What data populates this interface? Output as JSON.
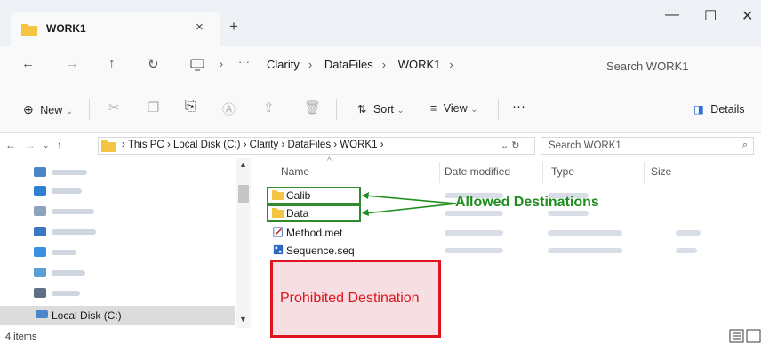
{
  "tab": {
    "title": "WORK1",
    "close": "×",
    "new_tab": "+"
  },
  "window_controls": {
    "minimize": "—",
    "maximize": "☐",
    "close": "✕"
  },
  "nav": {
    "back": "←",
    "forward": "→",
    "up": "↑",
    "refresh": "↻",
    "more": "···"
  },
  "breadcrumbs": [
    "Clarity",
    "DataFiles",
    "WORK1"
  ],
  "search": {
    "placeholder": "Search WORK1"
  },
  "toolbar": {
    "new_label": "New",
    "sort_label": "Sort",
    "view_label": "View",
    "more_label": "···",
    "details_label": "Details"
  },
  "classic_address": {
    "path": [
      "This PC",
      "Local Disk (C:)",
      "Clarity",
      "DataFiles",
      "WORK1"
    ],
    "search_placeholder": "Search WORK1"
  },
  "nav_pane": {
    "items": [
      {
        "icon": "3d-objects-icon",
        "color": "#4a86c8"
      },
      {
        "icon": "desktop-icon",
        "color": "#2f7fd3"
      },
      {
        "icon": "documents-icon",
        "color": "#8da4bf"
      },
      {
        "icon": "downloads-icon",
        "color": "#3a78c6"
      },
      {
        "icon": "music-icon",
        "color": "#3b8fe0"
      },
      {
        "icon": "pictures-icon",
        "color": "#5a9ed6"
      },
      {
        "icon": "videos-icon",
        "color": "#5f6f85"
      }
    ],
    "selected_label": "Local Disk (C:)"
  },
  "columns": {
    "name": "Name",
    "date_modified": "Date modified",
    "type": "Type",
    "size": "Size"
  },
  "files": [
    {
      "name": "Calib",
      "icon": "folder-icon"
    },
    {
      "name": "Data",
      "icon": "folder-icon"
    },
    {
      "name": "Method.met",
      "icon": "method-file-icon"
    },
    {
      "name": "Sequence.seq",
      "icon": "sequence-file-icon"
    }
  ],
  "annotations": {
    "allowed": "Allowed Destinations",
    "prohibited": "Prohibited  Destination"
  },
  "status": {
    "item_count": "4 items"
  },
  "colors": {
    "allowed": "#1e8e1e",
    "prohibited": "#e0141e",
    "folder": "#f4c542"
  }
}
